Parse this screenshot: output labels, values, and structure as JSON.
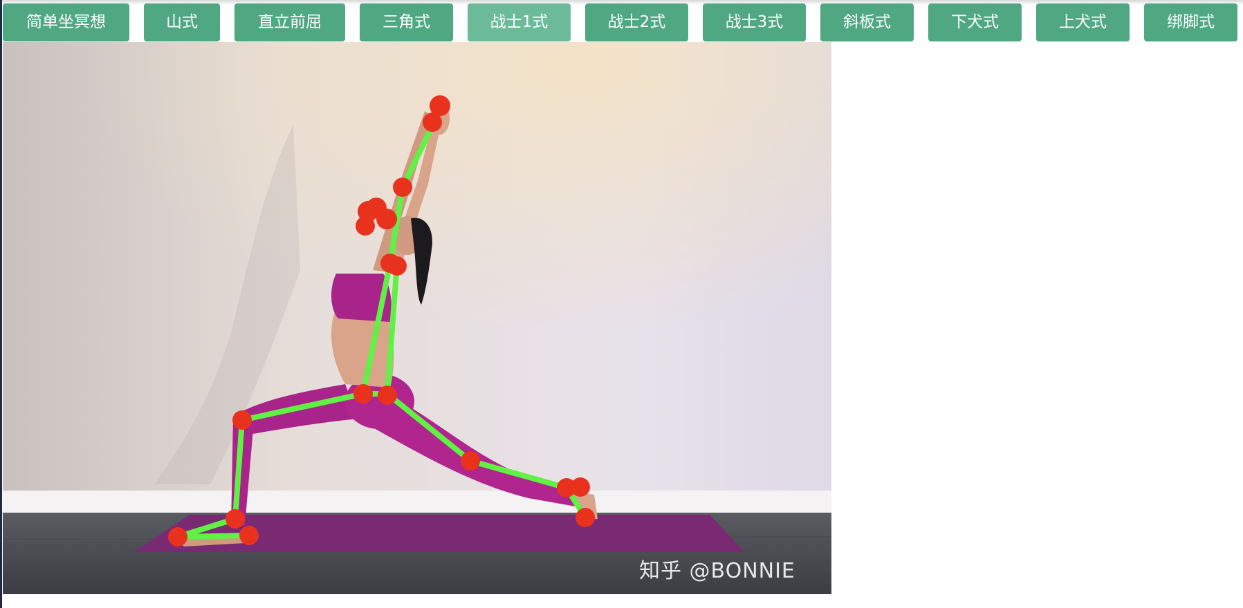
{
  "pose_buttons": [
    {
      "label": "简单坐冥想",
      "active": false
    },
    {
      "label": "山式",
      "active": false
    },
    {
      "label": "直立前屈",
      "active": false
    },
    {
      "label": "三角式",
      "active": false
    },
    {
      "label": "战士1式",
      "active": true
    },
    {
      "label": "战士2式",
      "active": false
    },
    {
      "label": "战士3式",
      "active": false
    },
    {
      "label": "斜板式",
      "active": false
    },
    {
      "label": "下犬式",
      "active": false
    },
    {
      "label": "上犬式",
      "active": false
    },
    {
      "label": "绑脚式",
      "active": false
    }
  ],
  "photo": {
    "watermark": "知乎 @BONNIE"
  },
  "colors": {
    "button_bg": "#4fa882",
    "button_active_bg": "#6bbb9b",
    "skeleton_line": "#5ff244",
    "keypoint": "#e8321e"
  }
}
